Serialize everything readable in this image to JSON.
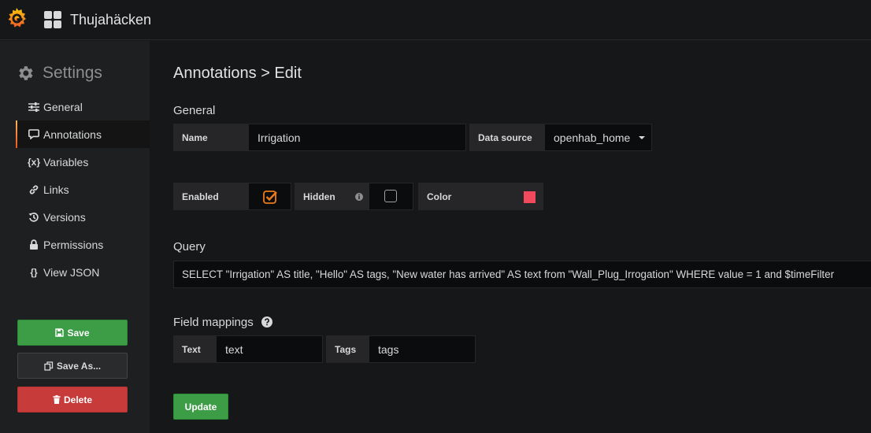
{
  "header": {
    "dashboard_title": "Thujahäcken"
  },
  "sidebar": {
    "title": "Settings",
    "items": [
      {
        "label": "General",
        "icon": "sliders-icon"
      },
      {
        "label": "Annotations",
        "icon": "comment-icon",
        "active": true
      },
      {
        "label": "Variables",
        "icon": "variable-icon",
        "glyph": "{x}"
      },
      {
        "label": "Links",
        "icon": "link-icon"
      },
      {
        "label": "Versions",
        "icon": "history-icon"
      },
      {
        "label": "Permissions",
        "icon": "lock-icon"
      },
      {
        "label": "View JSON",
        "icon": "json-icon",
        "glyph": "{}"
      }
    ],
    "save_label": "Save",
    "save_as_label": "Save As...",
    "delete_label": "Delete"
  },
  "main": {
    "title": "Annotations > Edit",
    "general": {
      "heading": "General",
      "name_label": "Name",
      "name_value": "Irrigation",
      "datasource_label": "Data source",
      "datasource_value": "openhab_home",
      "enabled_label": "Enabled",
      "enabled": true,
      "hidden_label": "Hidden",
      "hidden": false,
      "color_label": "Color",
      "color_value": "#f2495c"
    },
    "query": {
      "heading": "Query",
      "value": "SELECT \"Irrigation\" AS title, \"Hello\" AS tags, \"New water has arrived\" AS text from  \"Wall_Plug_Irrogation\" WHERE value = 1 and $timeFilter"
    },
    "field_mappings": {
      "heading": "Field mappings",
      "text_label": "Text",
      "text_value": "text",
      "tags_label": "Tags",
      "tags_value": "tags"
    },
    "update_label": "Update"
  },
  "colors": {
    "accent": "#eb7b18",
    "success": "#3d9d47",
    "danger": "#c73b3b"
  }
}
